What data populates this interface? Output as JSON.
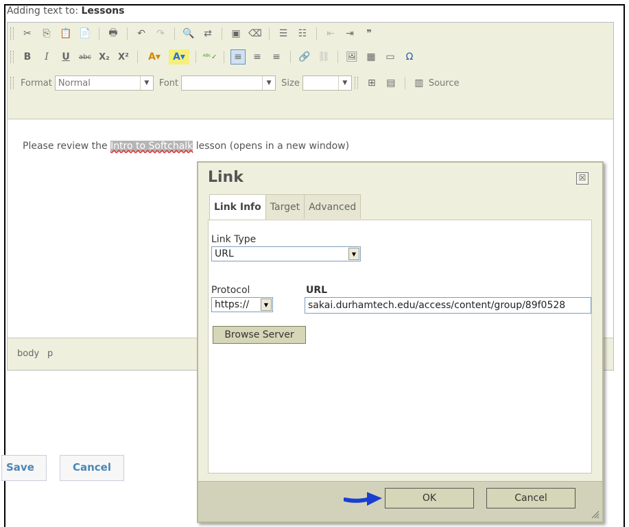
{
  "header": {
    "prefix": "Adding text to: ",
    "title": "Lessons"
  },
  "toolbar": {
    "row1_icons": [
      "cut-icon",
      "copy-icon",
      "paste-icon",
      "paste-word-icon",
      "print-icon",
      "undo-icon",
      "redo-icon",
      "find-icon",
      "replace-icon",
      "select-all-icon",
      "remove-format-icon",
      "numbered-list-icon",
      "bulleted-list-icon",
      "outdent-icon",
      "indent-icon",
      "blockquote-icon"
    ],
    "row2_icons": [
      "bold-icon",
      "italic-icon",
      "underline-icon",
      "strike-icon",
      "subscript-icon",
      "superscript-icon",
      "text-color-icon",
      "bg-color-icon",
      "spellcheck-icon",
      "align-left-icon",
      "align-center-icon",
      "align-right-icon",
      "link-icon",
      "unlink-icon",
      "image-icon",
      "table-icon",
      "hr-icon",
      "special-char-icon"
    ],
    "format_label": "Format",
    "format_value": "Normal",
    "font_label": "Font",
    "font_value": "",
    "size_label": "Size",
    "size_value": "",
    "source_label": "Source"
  },
  "content": {
    "before": "Please review the ",
    "link_text": "Intro to Softchalk",
    "after": " lesson (opens in a new window)"
  },
  "path": {
    "items": [
      "body",
      "p"
    ]
  },
  "buttons": {
    "save": "Save",
    "cancel": "Cancel"
  },
  "dialog": {
    "title": "Link",
    "close_glyph": "☒",
    "tabs": [
      {
        "label": "Link Info",
        "active": true
      },
      {
        "label": "Target",
        "active": false
      },
      {
        "label": "Advanced",
        "active": false
      }
    ],
    "link_type_label": "Link Type",
    "link_type_value": "URL",
    "protocol_label": "Protocol",
    "protocol_value": "https://",
    "url_label": "URL",
    "url_value": "sakai.durhamtech.edu/access/content/group/89f0528",
    "browse_label": "Browse Server",
    "ok_label": "OK",
    "cancel_label": "Cancel"
  },
  "colors": {
    "accent": "#4a86b5",
    "dialog_bg": "#efefde",
    "arrow": "#1a3fd0"
  }
}
